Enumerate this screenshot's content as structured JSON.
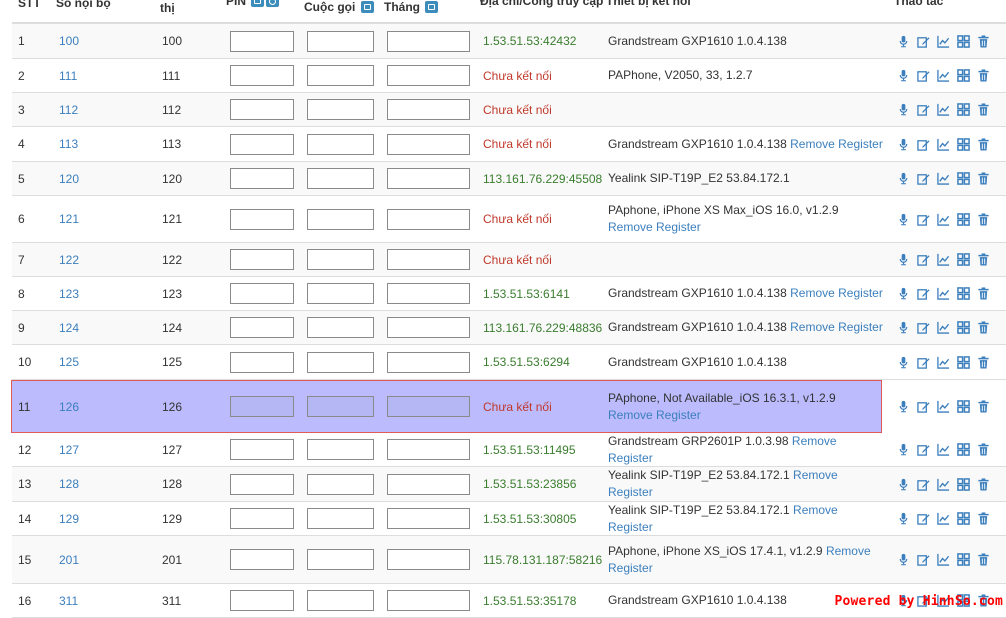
{
  "headers": {
    "stt": "STT",
    "ext": "Số nội bộ",
    "disp": "thị",
    "pin": "PIN",
    "calls": "Cuộc gọi",
    "month": "Tháng",
    "addr": "Địa chỉ/Cổng truy cập",
    "dev": "Thiết bị kết nối",
    "act": "Thao tác"
  },
  "rows": [
    {
      "stt": "1",
      "ext": "100",
      "disp": "100",
      "pin": "",
      "calls": "",
      "month": "",
      "addr": "1.53.51.53:42432",
      "status": "ok",
      "dev": "Grandstream GXP1610 1.0.4.138",
      "remove": ""
    },
    {
      "stt": "2",
      "ext": "111",
      "disp": "111",
      "pin": "",
      "calls": "",
      "month": "",
      "addr": "Chưa kết nối",
      "status": "bad",
      "dev": "PAPhone, V2050, 33, 1.2.7",
      "remove": ""
    },
    {
      "stt": "3",
      "ext": "112",
      "disp": "112",
      "pin": "",
      "calls": "",
      "month": "",
      "addr": "Chưa kết nối",
      "status": "bad",
      "dev": "",
      "remove": ""
    },
    {
      "stt": "4",
      "ext": "113",
      "disp": "113",
      "pin": "",
      "calls": "",
      "month": "",
      "addr": "Chưa kết nối",
      "status": "bad",
      "dev": "Grandstream GXP1610 1.0.4.138",
      "remove": "Remove Register"
    },
    {
      "stt": "5",
      "ext": "120",
      "disp": "120",
      "pin": "",
      "calls": "",
      "month": "",
      "addr": "113.161.76.229:45508",
      "status": "ok",
      "dev": "Yealink SIP-T19P_E2 53.84.172.1",
      "remove": ""
    },
    {
      "stt": "6",
      "ext": "121",
      "disp": "121",
      "pin": "",
      "calls": "",
      "month": "",
      "addr": "Chưa kết nối",
      "status": "bad",
      "dev": "PAphone, iPhone XS Max_iOS 16.0, v1.2.9",
      "remove": "Remove Register"
    },
    {
      "stt": "7",
      "ext": "122",
      "disp": "122",
      "pin": "",
      "calls": "",
      "month": "",
      "addr": "Chưa kết nối",
      "status": "bad",
      "dev": "",
      "remove": ""
    },
    {
      "stt": "8",
      "ext": "123",
      "disp": "123",
      "pin": "",
      "calls": "",
      "month": "",
      "addr": "1.53.51.53:6141",
      "status": "ok",
      "dev": "Grandstream GXP1610 1.0.4.138",
      "remove": "Remove Register"
    },
    {
      "stt": "9",
      "ext": "124",
      "disp": "124",
      "pin": "",
      "calls": "",
      "month": "",
      "addr": "113.161.76.229:48836",
      "status": "ok",
      "dev": "Grandstream GXP1610 1.0.4.138",
      "remove": "Remove Register"
    },
    {
      "stt": "10",
      "ext": "125",
      "disp": "125",
      "pin": "",
      "calls": "",
      "month": "",
      "addr": "1.53.51.53:6294",
      "status": "ok",
      "dev": "Grandstream GXP1610 1.0.4.138",
      "remove": ""
    },
    {
      "stt": "11",
      "ext": "126",
      "disp": "126",
      "pin": "",
      "calls": "",
      "month": "",
      "addr": "Chưa kết nối",
      "status": "bad",
      "dev": "PAphone, Not Available_iOS 16.3.1, v1.2.9",
      "remove": "Remove Register",
      "selected": true
    },
    {
      "stt": "12",
      "ext": "127",
      "disp": "127",
      "pin": "",
      "calls": "",
      "month": "",
      "addr": "1.53.51.53:11495",
      "status": "ok",
      "dev": "Grandstream GRP2601P 1.0.3.98",
      "remove": "Remove Register"
    },
    {
      "stt": "13",
      "ext": "128",
      "disp": "128",
      "pin": "",
      "calls": "",
      "month": "",
      "addr": "1.53.51.53:23856",
      "status": "ok",
      "dev": "Yealink SIP-T19P_E2 53.84.172.1",
      "remove": "Remove Register"
    },
    {
      "stt": "14",
      "ext": "129",
      "disp": "129",
      "pin": "",
      "calls": "",
      "month": "",
      "addr": "1.53.51.53:30805",
      "status": "ok",
      "dev": "Yealink SIP-T19P_E2 53.84.172.1",
      "remove": "Remove Register"
    },
    {
      "stt": "15",
      "ext": "201",
      "disp": "201",
      "pin": "",
      "calls": "",
      "month": "",
      "addr": "115.78.131.187:58216",
      "status": "ok",
      "dev": "PAphone, iPhone XS_iOS 17.4.1, v1.2.9",
      "remove": "Remove Register"
    },
    {
      "stt": "16",
      "ext": "311",
      "disp": "311",
      "pin": "",
      "calls": "",
      "month": "",
      "addr": "1.53.51.53:35178",
      "status": "ok",
      "dev": "Grandstream GXP1610 1.0.4.138",
      "remove": ""
    }
  ],
  "actions": [
    {
      "name": "mic-icon"
    },
    {
      "name": "edit-icon"
    },
    {
      "name": "chart-icon"
    },
    {
      "name": "grid-icon"
    },
    {
      "name": "trash-icon"
    }
  ],
  "colors": {
    "link": "#3c7fbd",
    "ok": "#3a7d2e",
    "bad": "#c0392b",
    "selected_row": "#bbbbfd",
    "selected_border": "#e05a5a",
    "watermark": "#ff0000"
  },
  "watermark": "Powered by HinhSo.com"
}
